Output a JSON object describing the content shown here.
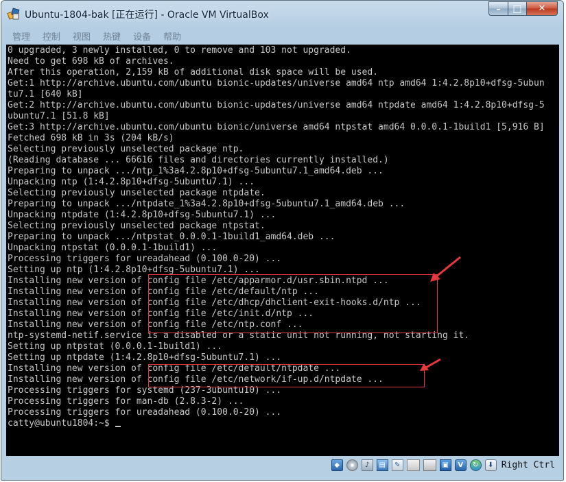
{
  "window": {
    "title": "Ubuntu-1804-bak [正在运行] - Oracle VM VirtualBox",
    "buttons": {
      "minimize": "–",
      "maximize": "□",
      "close": "✕"
    }
  },
  "menu": [
    "管理",
    "控制",
    "视图",
    "热键",
    "设备",
    "帮助"
  ],
  "terminal": {
    "lines": [
      "0 upgraded, 3 newly installed, 0 to remove and 103 not upgraded.",
      "Need to get 698 kB of archives.",
      "After this operation, 2,159 kB of additional disk space will be used.",
      "Get:1 http://archive.ubuntu.com/ubuntu bionic-updates/universe amd64 ntp amd64 1:4.2.8p10+dfsg-5ubun",
      "tu7.1 [640 kB]",
      "Get:2 http://archive.ubuntu.com/ubuntu bionic-updates/universe amd64 ntpdate amd64 1:4.2.8p10+dfsg-5",
      "ubuntu7.1 [51.8 kB]",
      "Get:3 http://archive.ubuntu.com/ubuntu bionic/universe amd64 ntpstat amd64 0.0.0.1-1build1 [5,916 B]",
      "Fetched 698 kB in 3s (204 kB/s)",
      "Selecting previously unselected package ntp.",
      "(Reading database ... 66616 files and directories currently installed.)",
      "Preparing to unpack .../ntp_1%3a4.2.8p10+dfsg-5ubuntu7.1_amd64.deb ...",
      "Unpacking ntp (1:4.2.8p10+dfsg-5ubuntu7.1) ...",
      "Selecting previously unselected package ntpdate.",
      "Preparing to unpack .../ntpdate_1%3a4.2.8p10+dfsg-5ubuntu7.1_amd64.deb ...",
      "Unpacking ntpdate (1:4.2.8p10+dfsg-5ubuntu7.1) ...",
      "Selecting previously unselected package ntpstat.",
      "Preparing to unpack .../ntpstat_0.0.0.1-1build1_amd64.deb ...",
      "Unpacking ntpstat (0.0.0.1-1build1) ...",
      "Processing triggers for ureadahead (0.100.0-20) ...",
      "Setting up ntp (1:4.2.8p10+dfsg-5ubuntu7.1) ...",
      "Installing new version of config file /etc/apparmor.d/usr.sbin.ntpd ...",
      "Installing new version of config file /etc/default/ntp ...",
      "Installing new version of config file /etc/dhcp/dhclient-exit-hooks.d/ntp ...",
      "Installing new version of config file /etc/init.d/ntp ...",
      "Installing new version of config file /etc/ntp.conf ...",
      "ntp-systemd-netif.service is a disabled or a static unit not running, not starting it.",
      "Setting up ntpstat (0.0.0.1-1build1) ...",
      "Setting up ntpdate (1:4.2.8p10+dfsg-5ubuntu7.1) ...",
      "Installing new version of config file /etc/default/ntpdate ...",
      "Installing new version of config file /etc/network/if-up.d/ntpdate ...",
      "Processing triggers for systemd (237-3ubuntu10) ...",
      "Processing triggers for man-db (2.8.3-2) ...",
      "Processing triggers for ureadahead (0.100.0-20) ...",
      "catty@ubuntu1804:~$ "
    ]
  },
  "status": {
    "icons": [
      "hard-disk-icon",
      "optical-drive-icon",
      "audio-icon",
      "network-icon",
      "usb-icon",
      "shared-folder-icon",
      "display-icon",
      "recording-icon",
      "cpu-icon",
      "mouse-integration-icon",
      "host-key-arrow-icon"
    ],
    "host_key": "Right Ctrl"
  },
  "colors": {
    "annotation": "#e8383d",
    "terminal_text": "#c8c8c8",
    "frame": "#b7cfe3"
  }
}
